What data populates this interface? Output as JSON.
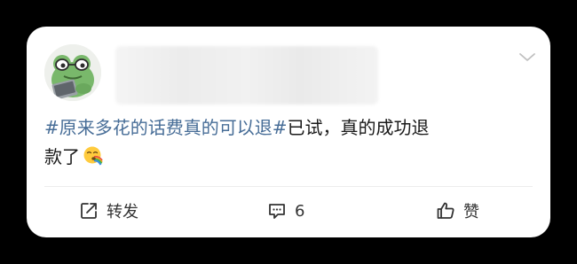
{
  "post": {
    "hashtag": "#原来多花的话费真的可以退#",
    "text_part1": "已试，真的成功退",
    "text_part2": "款了",
    "emoji": "rainbow-vomit-emoji"
  },
  "actions": {
    "repost_label": "转发",
    "comment_count": "6",
    "like_label": "赞"
  },
  "icons": {
    "more": "chevron-down-icon",
    "repost": "share-arrow-icon",
    "comment": "comment-bubble-icon",
    "like": "thumbs-up-icon"
  },
  "colors": {
    "hashtag": "#476d97",
    "text": "#1a1a1a",
    "background": "#000000",
    "card": "#ffffff"
  }
}
